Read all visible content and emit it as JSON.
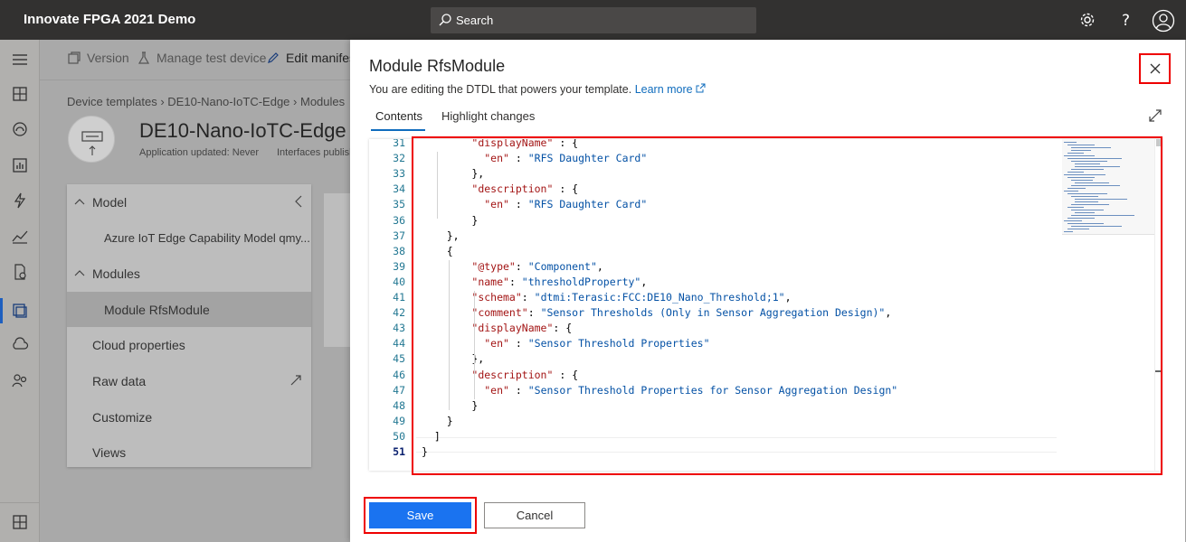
{
  "app": {
    "title": "Innovate FPGA 2021 Demo",
    "search_placeholder": "Search"
  },
  "header_icons": [
    "gear-icon",
    "help-icon",
    "account-icon"
  ],
  "toolbar": {
    "version": "Version",
    "manage_test_device": "Manage test device",
    "edit_manifest": "Edit manifest"
  },
  "breadcrumb": {
    "part1": "Device templates",
    "part2": "DE10-Nano-IoTC-Edge",
    "part3": "Modules"
  },
  "device": {
    "title": "DE10-Nano-IoTC-Edge",
    "updated": "Application updated: Never",
    "interfaces": "Interfaces publisht"
  },
  "nav": {
    "model": "Model",
    "capability_model": "Azure IoT Edge Capability Model qmy...",
    "modules": "Modules",
    "module_rfs": "Module RfsModule",
    "cloud_properties": "Cloud properties",
    "raw_data": "Raw data",
    "customize": "Customize",
    "views": "Views"
  },
  "modal": {
    "title": "Module RfsModule",
    "subtitle": "You are editing the DTDL that powers your template.",
    "learn_more": "Learn more",
    "tab_contents": "Contents",
    "tab_highlight": "Highlight changes",
    "save": "Save",
    "cancel": "Cancel"
  },
  "editor": {
    "line_numbers": [
      "31",
      "32",
      "33",
      "34",
      "35",
      "36",
      "37",
      "38",
      "39",
      "40",
      "41",
      "42",
      "43",
      "44",
      "45",
      "46",
      "47",
      "48",
      "49",
      "50",
      "51"
    ],
    "lines": [
      "        \"displayName\" : {",
      "          \"en\" : \"RFS Daughter Card\"",
      "        },",
      "        \"description\" : {",
      "          \"en\" : \"RFS Daughter Card\"",
      "        }",
      "    },",
      "    {",
      "        \"@type\": \"Component\",",
      "        \"name\": \"thresholdProperty\",",
      "        \"schema\": \"dtmi:Terasic:FCC:DE10_Nano_Threshold;1\",",
      "        \"comment\": \"Sensor Thresholds (Only in Sensor Aggregation Design)\",",
      "        \"displayName\": {",
      "          \"en\" : \"Sensor Threshold Properties\"",
      "        },",
      "        \"description\" : {",
      "          \"en\" : \"Sensor Threshold Properties for Sensor Aggregation Design\"",
      "        }",
      "    }",
      "  ]",
      "}"
    ]
  }
}
